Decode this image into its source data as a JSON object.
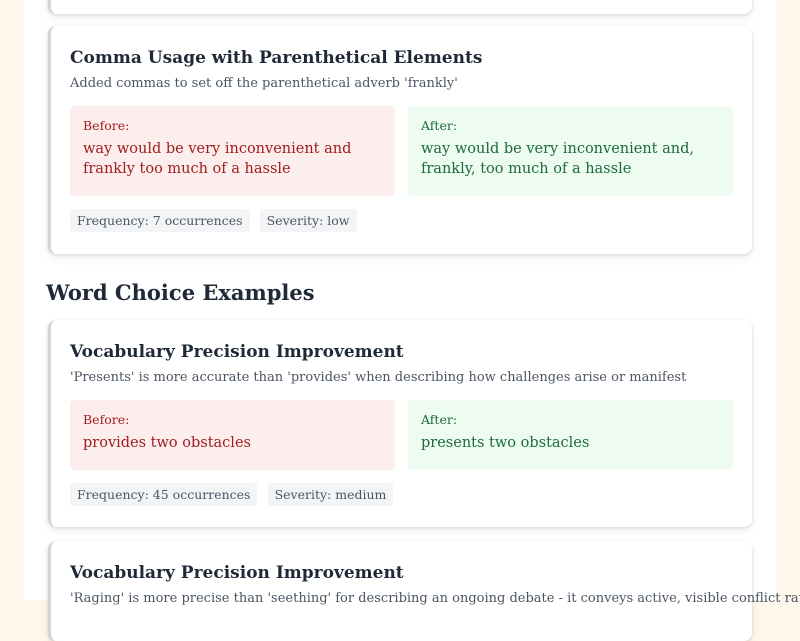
{
  "sections": {
    "word_choice_heading": "Word Choice Examples"
  },
  "cards": [
    {
      "title": "Comma Usage with Parenthetical Elements",
      "description": "Added commas to set off the parenthetical adverb 'frankly'",
      "before_label": "Before:",
      "before_text": "way would be very inconvenient and frankly too much of a hassle",
      "after_label": "After:",
      "after_text": "way would be very inconvenient and, frankly, too much of a hassle",
      "frequency": "Frequency: 7 occurrences",
      "severity": "Severity: low"
    },
    {
      "title": "Vocabulary Precision Improvement",
      "description": "'Presents' is more accurate than 'provides' when describing how challenges arise or manifest",
      "before_label": "Before:",
      "before_text": "provides two obstacles",
      "after_label": "After:",
      "after_text": "presents two obstacles",
      "frequency": "Frequency: 45 occurrences",
      "severity": "Severity: medium"
    },
    {
      "title": "Vocabulary Precision Improvement",
      "description": "'Raging' is more precise than 'seething' for describing an ongoing debate - it conveys active, visible conflict rather"
    }
  ],
  "colors": {
    "before_bg": "#fdeeee",
    "before_text": "#a11c1c",
    "after_bg": "#eefbf1",
    "after_text": "#1d6b3a"
  }
}
